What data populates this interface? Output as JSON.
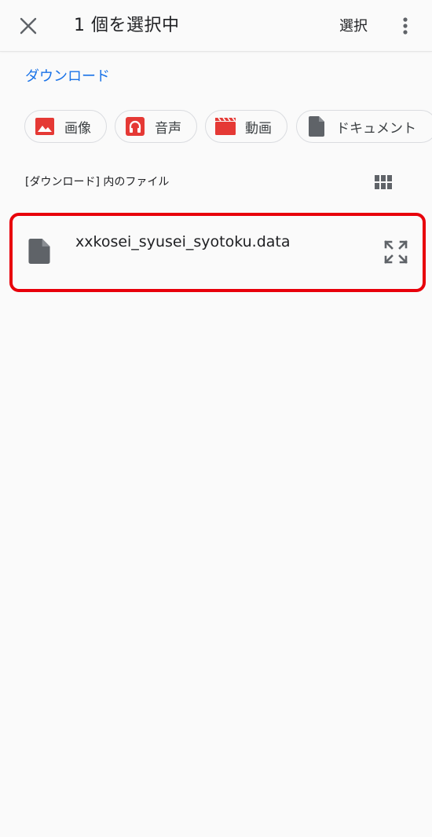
{
  "header": {
    "close_icon": "close-icon",
    "title": "1 個を選択中",
    "select_label": "選択",
    "more_icon": "more-vert-icon"
  },
  "breadcrumb": {
    "label": "ダウンロード"
  },
  "filter_chips": [
    {
      "label": "画像",
      "icon": "image-icon",
      "color": "#e53935"
    },
    {
      "label": "音声",
      "icon": "headphones-icon",
      "color": "#e53935"
    },
    {
      "label": "動画",
      "icon": "movie-icon",
      "color": "#e53935"
    },
    {
      "label": "ドキュメント",
      "icon": "document-icon",
      "color": "#5f6368"
    }
  ],
  "section": {
    "label": "[ダウンロード] 内のファイル",
    "view_icon": "grid-view-icon"
  },
  "files": [
    {
      "name": "xxkosei_syusei_syotoku.data",
      "icon": "file-icon",
      "selected": true
    }
  ],
  "colors": {
    "accent": "#1a73e8",
    "highlight_border": "#e8000b",
    "chip_icon_red": "#e53935",
    "icon_gray": "#5f6368"
  }
}
